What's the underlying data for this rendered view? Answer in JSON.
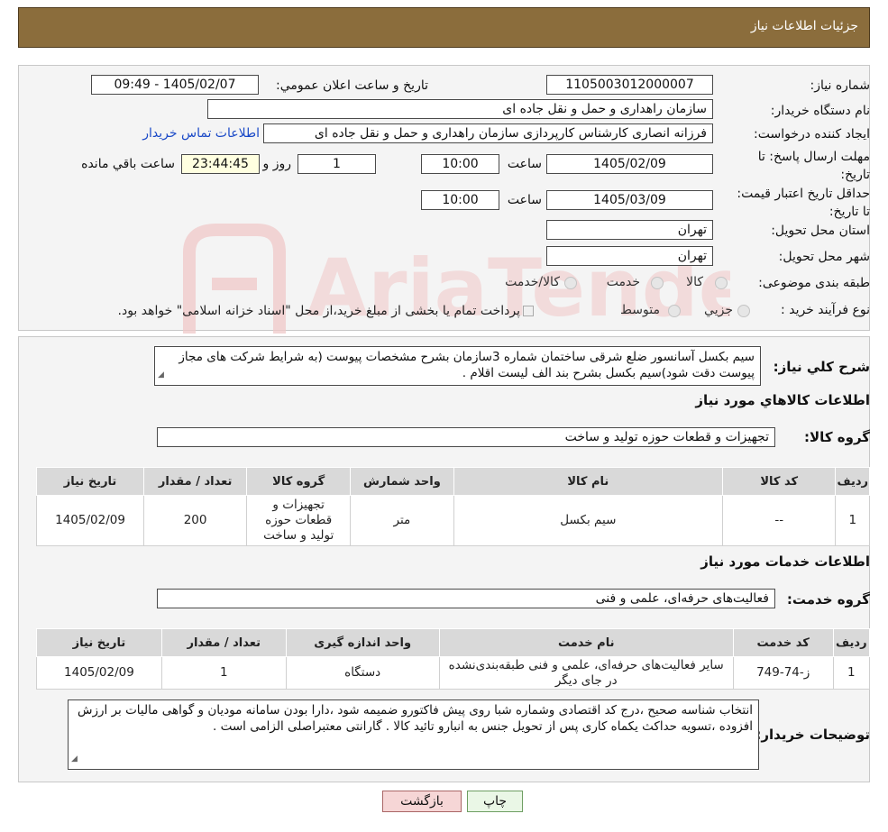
{
  "header": {
    "title": "جزئیات اطلاعات نیاز"
  },
  "labels": {
    "need_number": "شماره نیاز:",
    "announce_datetime": "تاریخ و ساعت اعلان عمومي:",
    "buyer_org": "نام دستگاه خریدار:",
    "requester": "ایجاد کننده درخواست:",
    "send_deadline": "مهلت ارسال پاسخ: تا تاریخ:",
    "hour": "ساعت",
    "day_and": "روز و",
    "remaining": "ساعت باقي مانده",
    "price_validity": "حداقل تاریخ اعتبار قیمت: تا تاریخ:",
    "delivery_province": "استان محل تحویل:",
    "delivery_city": "شهر محل تحویل:",
    "category": "طبقه بندی موضوعی:",
    "purchase_type": "نوع فرآیند خرید :",
    "general_desc": "شرح کلي نیاز:",
    "goods_info": "اطلاعات کالاهاي مورد نياز",
    "goods_group": "گروه کالا:",
    "services_info": "اطلاعات خدمات مورد نیاز",
    "service_group": "گروه خدمت:",
    "buyer_notes": "توضیحات خریدار:"
  },
  "values": {
    "need_number": "1105003012000007",
    "announce_datetime": "1405/02/07 - 09:49",
    "buyer_org": "سازمان راهداری و حمل و نقل جاده ای",
    "requester": "فرزانه انصاری کارشناس کارپردازی سازمان راهداری و حمل و نقل جاده ای",
    "contact_link": "اطلاعات تماس خریدار",
    "send_date": "1405/02/09",
    "send_time": "10:00",
    "days": "1",
    "remaining_time": "23:44:45",
    "validity_date": "1405/03/09",
    "validity_time": "10:00",
    "province": "تهران",
    "city": "تهران",
    "general_desc": "سیم بکسل آسانسور ضلع شرقی ساختمان شماره 3سازمان بشرح مشخصات پیوست (به شرایط شرکت های مجاز پیوست دقت شود)سیم بکسل بشرح بند الف لیست اقلام .",
    "goods_group": "تجهیزات و قطعات حوزه تولید و ساخت",
    "service_group": "فعالیت‌های حرفه‌ای، علمی و فنی",
    "buyer_notes": "انتخاب شناسه صحیح ،درج کد اقتصادی وشماره شبا روی پیش فاکتورو ضمیمه شود ،دارا بودن سامانه مودیان و گواهی مالیات بر ارزش افزوده ،تسویه حداکث یکماه کاری پس از تحویل جنس به انبارو تائید کالا . گارانتی معتبراصلی الزامی است ."
  },
  "category_options": [
    "کالا",
    "خدمت",
    "کالا/خدمت"
  ],
  "purchase_options": [
    "جزيي",
    "متوسط"
  ],
  "purchase_note": "پرداخت تمام یا بخشی از مبلغ خرید،از محل \"اسناد خزانه اسلامی\" خواهد بود.",
  "goods_table": {
    "headers": [
      "رديف",
      "کد کالا",
      "نام کالا",
      "واحد شمارش",
      "گروه کالا",
      "تعداد / مقدار",
      "تاریخ نیاز"
    ],
    "rows": [
      [
        "1",
        "--",
        "سیم بکسل",
        "متر",
        "تجهیزات و قطعات حوزه تولید و ساخت",
        "200",
        "1405/02/09"
      ]
    ]
  },
  "services_table": {
    "headers": [
      "رديف",
      "کد خدمت",
      "نام خدمت",
      "واحد اندازه گیری",
      "تعداد / مقدار",
      "تاریخ نیاز"
    ],
    "rows": [
      [
        "1",
        "ز-74-749",
        "سایر فعالیت‌های حرفه‌ای، علمی و فنی طبقه‌بندی‌نشده در جای دیگر",
        "دستگاه",
        "1",
        "1405/02/09"
      ]
    ]
  },
  "buttons": {
    "print": "چاپ",
    "back": "بازگشت"
  },
  "watermark_text": "AriaTender.neT",
  "colors": {
    "header": "#8b6d3c",
    "link": "#1a49c7",
    "back_button": "#f6d6d6",
    "print_button": "#eaf7e6"
  }
}
